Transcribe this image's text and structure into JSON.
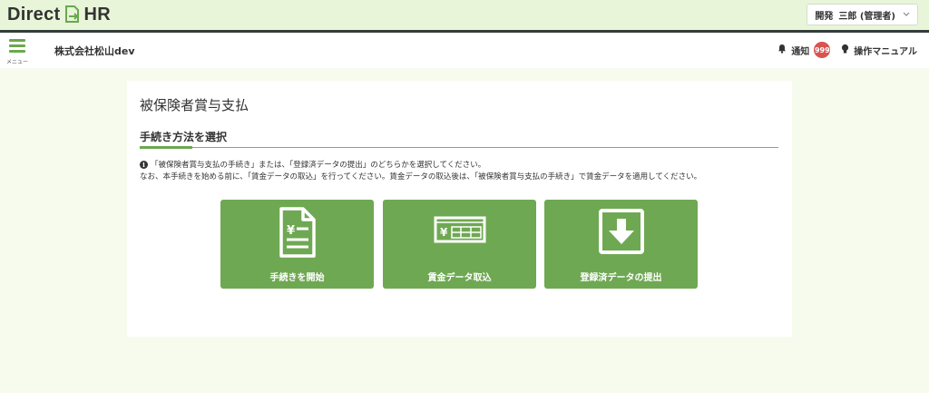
{
  "brand": {
    "logo_left": "Direct",
    "logo_right": "HR"
  },
  "user_menu": {
    "env_label": "開発",
    "user_name": "三郎 (管理者)"
  },
  "header": {
    "menu_label": "メニュー",
    "company": "株式会社松山dev",
    "notifications_label": "通知",
    "notifications_count": "999",
    "manual_label": "操作マニュアル"
  },
  "main": {
    "title": "被保険者賞与支払",
    "section_title": "手続き方法を選択",
    "info_line1": "「被保険者賞与支払の手続き」または、「登録済データの提出」のどちらかを選択してください。",
    "info_line2": "なお、本手続きを始める前に、「賃金データの取込」を行ってください。賃金データの取込後は、「被保険者賞与支払の手続き」で賃金データを適用してください。",
    "actions": [
      {
        "label": "手続きを開始",
        "icon": "yen-document-icon"
      },
      {
        "label": "賃金データ取込",
        "icon": "yen-card-icon"
      },
      {
        "label": "登録済データの提出",
        "icon": "download-icon"
      }
    ]
  },
  "colors": {
    "accent": "#6fa853",
    "topbar": "#e8f5d8",
    "badge": "#d9534f",
    "background": "#f7fbee"
  }
}
